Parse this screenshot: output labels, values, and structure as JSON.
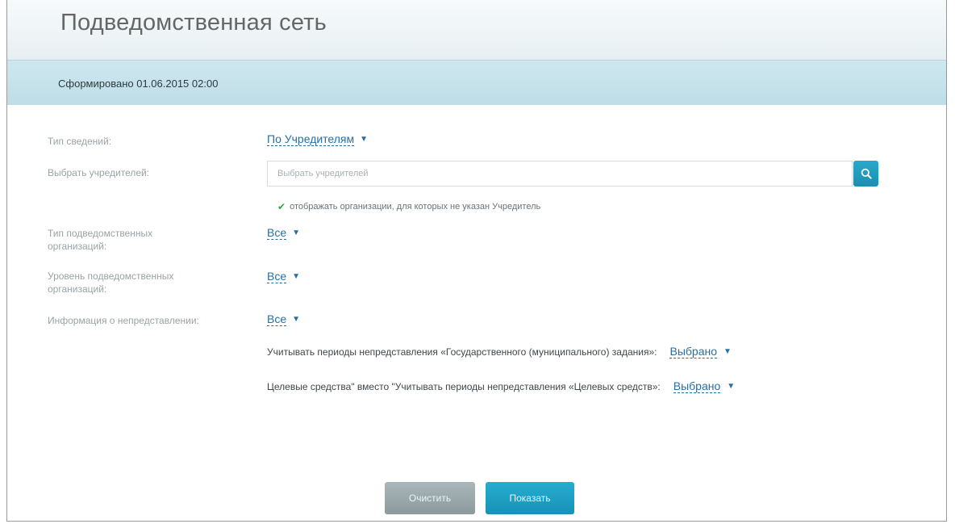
{
  "page": {
    "title": "Подведомственная сеть",
    "generated_label": "Сформировано 01.06.2015 02:00"
  },
  "filters": {
    "data_type": {
      "label": "Тип сведений:",
      "value": "По Учредителям"
    },
    "founders": {
      "label": "Выбрать учредителей:",
      "placeholder": "Выбрать учредителей",
      "show_without_founder": "отображать организации, для которых не указан Учредитель"
    },
    "org_type": {
      "label": "Тип подведомственных организаций:",
      "value": "Все"
    },
    "org_level": {
      "label": "Уровень подведомственных организаций:",
      "value": "Все"
    },
    "non_submission": {
      "label": "Информация о непредставлении:",
      "value": "Все"
    },
    "consider_state_task": {
      "label": "Учитывать периоды непредставления «Государственного (муниципального) задания»:",
      "value": "Выбрано"
    },
    "target_funds": {
      "label": "Целевые средства\" вместо \"Учитывать периоды непредставления «Целевых средств»:",
      "value": "Выбрано"
    }
  },
  "icons": {
    "search": "search-icon",
    "check": "checkmark-icon",
    "dropdown": "triangle-down-icon"
  },
  "actions": {
    "clear_label": "Очистить",
    "show_label": "Показать"
  },
  "colors": {
    "accent": "#1b9bc0",
    "link": "#2a6ea0",
    "header_bar": "#c6e2ea"
  }
}
